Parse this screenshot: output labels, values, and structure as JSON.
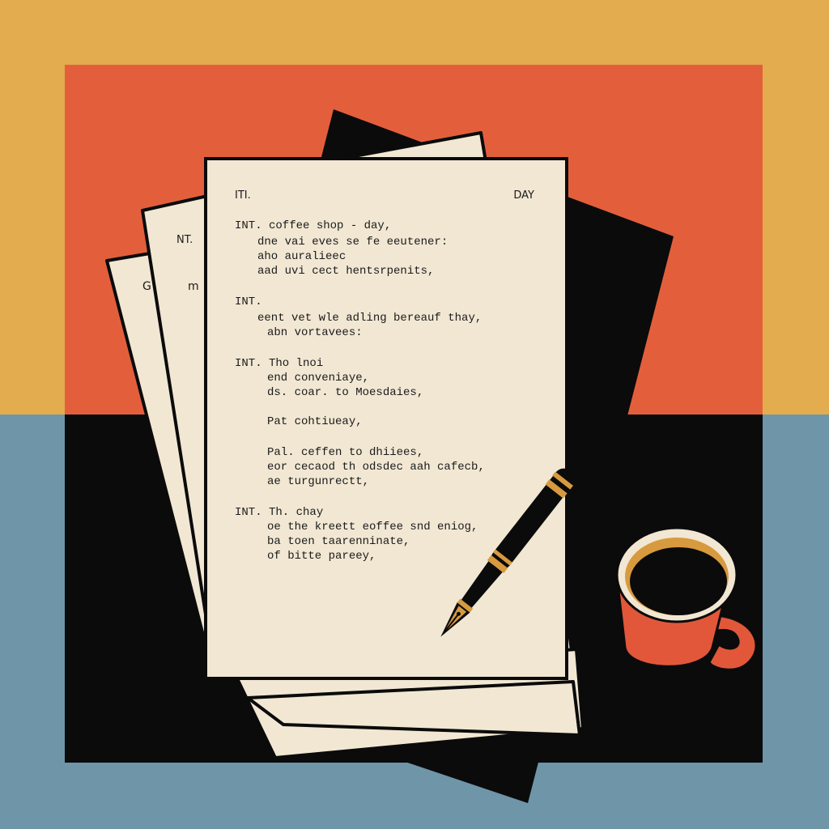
{
  "colors": {
    "top_band": "#e3ac4f",
    "bottom_band": "#6f95a9",
    "panel_red": "#e35f3c",
    "panel_black": "#0b0b0b",
    "paper": "#f1e7d3",
    "ink": "#1b1b1b",
    "accent_gold": "#d89a3e",
    "mug_orange": "#e2573a"
  },
  "back_pages": {
    "left_label": "G",
    "middle_top_label": "NT.",
    "middle_label": "m"
  },
  "page": {
    "header_left": "ITI.",
    "header_right": "DAY",
    "scenes": [
      {
        "heading": "INT.  coffee shop  - day,",
        "lines": [
          "dne vai eves se fe eeutener:",
          "aho auralieec",
          "aad uvi cect hentsrpenits,"
        ]
      },
      {
        "heading": "INT.",
        "lines": [
          "eent vet wle adling bereauf thay,",
          "abn vortavees:"
        ]
      },
      {
        "heading": "INT. Tho lnoi",
        "lines": [
          "end conveniaye,",
          "ds. coar. to Moesdaies,"
        ]
      },
      {
        "heading": "",
        "lines": [
          "Pat cohtiueay,"
        ]
      },
      {
        "heading": "",
        "lines": [
          "Pal. ceffen to dhiiees,",
          "eor cecaod th odsdec aah cafecb,",
          "ae turgunrectt,"
        ]
      },
      {
        "heading": "INT.  Th.  chay",
        "lines": [
          "oe the kreett eoffee snd eniog,",
          "ba toen taarenninate,",
          "of bitte pareey,"
        ]
      }
    ]
  },
  "icons": {
    "pen": "fountain-pen-icon",
    "mug": "coffee-mug-icon"
  }
}
